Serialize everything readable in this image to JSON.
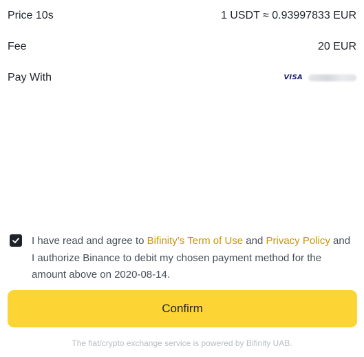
{
  "summary": {
    "price_label": "Price 10s",
    "price_value": "1 USDT ≈ 0.93997833 EUR",
    "fee_label": "Fee",
    "fee_value": "20 EUR",
    "pay_label": "Pay With",
    "card_brand": "VISA"
  },
  "agreement": {
    "checked": true,
    "text_before": "I have read and agree to ",
    "terms_link": "Bifinity’s Term of Use",
    "and": " and ",
    "privacy_link": "Privacy Policy",
    "text_after": " and I authorize Binance to debit my chosen payment method for the amount above on 2020-08-14."
  },
  "confirm_label": "Confirm",
  "footer_text": "The fiat/crypto exchange service is powered by Bifinity UAB.",
  "colors": {
    "accent_yellow": "#fcd535",
    "link_gold": "#c99400",
    "text_dark": "#1e2329"
  }
}
